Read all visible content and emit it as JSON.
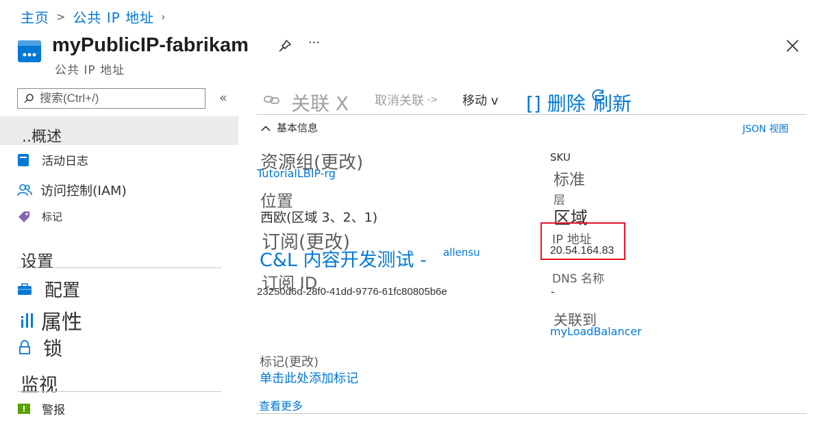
{
  "breadcrumb": {
    "home": "主页",
    "sep": ">",
    "parent": "公共 IP 地址"
  },
  "resource": {
    "name": "myPublicIP-fabrikam",
    "type": "公共 IP 地址",
    "more": "···"
  },
  "sidebar": {
    "search_placeholder": "搜索(Ctrl+/)",
    "collapse": "«",
    "items": [
      {
        "label": "..概述"
      },
      {
        "label": "活动日志"
      },
      {
        "label": "访问控制(IAM)"
      },
      {
        "label": "标记"
      }
    ],
    "settings": {
      "title": "设置",
      "items": [
        {
          "label": "配置"
        },
        {
          "label": "属性"
        },
        {
          "label": "锁"
        }
      ]
    },
    "monitoring": {
      "title": "监视",
      "items": [
        {
          "label": "警报"
        }
      ]
    }
  },
  "toolbar": {
    "associate": "关联 X",
    "dissociate": "取消关联",
    "move": "移动 v",
    "delete": "[] 删除",
    "refresh": "刷新"
  },
  "essentials": {
    "toggle": "基本信息",
    "json_view": "JSON 视图",
    "left": {
      "resource_group_label": "资源组(更改)",
      "resource_group_value": "TutorialLBIP-rg",
      "location_label": "位置",
      "location_value": "西欧(区域 3、2、1)",
      "subscription_label": "订阅(更改)",
      "subscription_value": "C&L 内容开发测试 -",
      "subscription_user": "allensu",
      "subscription_id_label": "订阅 ID",
      "subscription_id_value": "23250d6d-28f0-41dd-9776-61fc80805b6e"
    },
    "right": {
      "sku_label": "SKU",
      "sku_value": "标准",
      "tier_label": "层",
      "tier_value": "区域",
      "ip_label": "IP 地址",
      "ip_value": "20.54.164.83",
      "dns_label": "DNS 名称",
      "dns_value": "-",
      "associated_label": "关联到",
      "associated_value": "myLoadBalancer"
    },
    "tags_label": "标记(更改)",
    "tags_add": "单击此处添加标记",
    "view_more": "查看更多"
  },
  "colors": {
    "accent": "#0078d4",
    "highlight_border": "#e81123",
    "nav_active_bg": "#edebe9"
  }
}
